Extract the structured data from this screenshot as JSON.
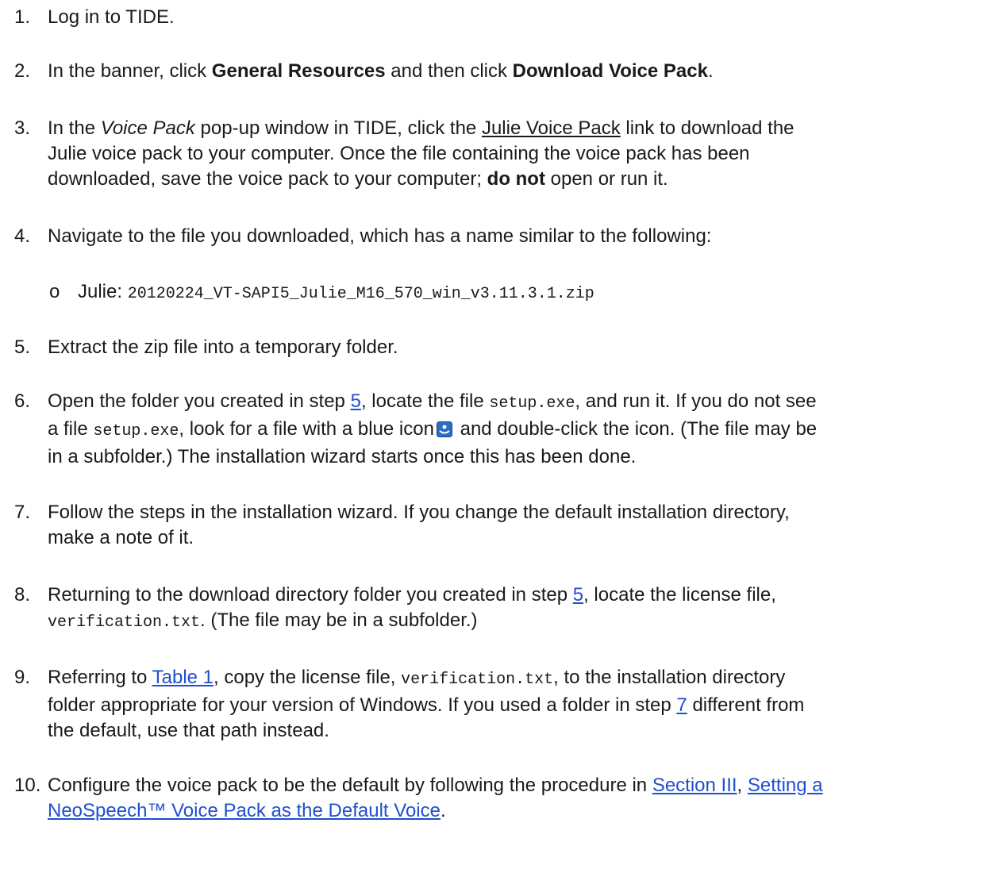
{
  "steps": {
    "s1": {
      "num": "1.",
      "a": "Log in to TIDE."
    },
    "s2": {
      "num": "2.",
      "a": "In the banner, click ",
      "b": "General Resources",
      "c": " and then click ",
      "d": "Download Voice Pack",
      "e": "."
    },
    "s3": {
      "num": "3.",
      "a": "In the ",
      "b": "Voice Pack",
      "c": " pop-up window in TIDE, click the ",
      "link": "Julie Voice Pack",
      "d": " link to download the",
      "l2": "Julie voice pack to your computer. Once the file containing the voice pack has been",
      "l3a": "downloaded, save the voice pack to your computer; ",
      "l3b": "do not",
      "l3c": " open or run it."
    },
    "s4": {
      "num": "4.",
      "a": "Navigate to the file you downloaded, which has a name similar to the following:",
      "bullet": "o",
      "sub_label": "Julie: ",
      "sub_file": "20120224_VT-SAPI5_Julie_M16_570_win_v3.11.3.1.zip"
    },
    "s5": {
      "num": "5.",
      "a": "Extract the zip file into a temporary folder."
    },
    "s6": {
      "num": "6.",
      "a": "Open the folder you created in step ",
      "link": "5",
      "b": ", locate the file ",
      "c": "setup.exe",
      "d": ", and run it. If you do not see",
      "l2a": "a file ",
      "l2b": "setup.exe",
      "l2c": ", look for a file with a blue icon",
      "l2d": " and double-click the icon. (The file may be",
      "l3": "in a subfolder.) The installation wizard starts once this has been done."
    },
    "s7": {
      "num": "7.",
      "a": "Follow the steps in the installation wizard. If you change the default installation directory,",
      "l2": "make a note of it."
    },
    "s8": {
      "num": "8.",
      "a": "Returning to the download directory folder you created in step ",
      "link": "5",
      "b": ", locate the license file,",
      "l2a": "verification.txt",
      "l2b": ". (The file may be in a subfolder.)"
    },
    "s9": {
      "num": "9.",
      "a": "Referring to ",
      "link": "Table 1",
      "b": ", copy the license file, ",
      "c": "verification.txt",
      "d": ", to the installation directory",
      "l2a": "folder appropriate for your version of Windows. If you used a folder in step ",
      "l2link": "7",
      "l2b": " different from",
      "l3": "the default, use that path instead."
    },
    "s10": {
      "num": "10.",
      "a": "Configure the voice pack to be the default by following the procedure in ",
      "link1": "Section III",
      "b": ", ",
      "link2a": "Setting a",
      "link2b": "NeoSpeech™ Voice Pack as the Default Voice",
      "c": "."
    }
  },
  "icons": {
    "setup_icon": "installer-icon",
    "color": "#2b6cc4"
  }
}
